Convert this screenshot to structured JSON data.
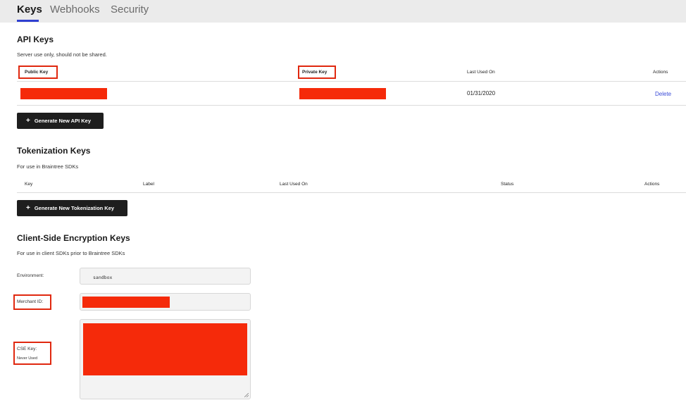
{
  "tabs": [
    {
      "label": "Keys",
      "active": true
    },
    {
      "label": "Webhooks",
      "active": false
    },
    {
      "label": "Security",
      "active": false
    }
  ],
  "api_keys": {
    "title": "API Keys",
    "subtitle": "Server use only, should not be shared.",
    "columns": [
      "Public Key",
      "Private Key",
      "Last Used On",
      "Actions"
    ],
    "rows": [
      {
        "public_key": "",
        "private_key": "",
        "last_used_on": "01/31/2020",
        "action": "Delete"
      }
    ],
    "generate_button": "Generate New API Key"
  },
  "tokenization_keys": {
    "title": "Tokenization Keys",
    "subtitle": "For use in Braintree SDKs",
    "columns": [
      "Key",
      "Label",
      "Last Used On",
      "Status",
      "Actions"
    ],
    "generate_button": "Generate New Tokenization Key"
  },
  "cse_keys": {
    "title": "Client-Side Encryption Keys",
    "subtitle": "For use in client SDKs prior to Braintree SDKs",
    "environment_label": "Environment:",
    "environment_value": "sandbox",
    "merchant_id_label": "Merchant ID:",
    "cse_key_label": "CSE Key:",
    "cse_key_status": "Never Used"
  },
  "colors": {
    "accent": "#2f3fd1",
    "redaction": "#f52a0a",
    "highlight_box": "#e0280f",
    "button_bg": "#1e1e1e",
    "link": "#3a4bd8"
  },
  "icons": {
    "plus": "+",
    "resize_handle": "textarea-resize-icon"
  }
}
